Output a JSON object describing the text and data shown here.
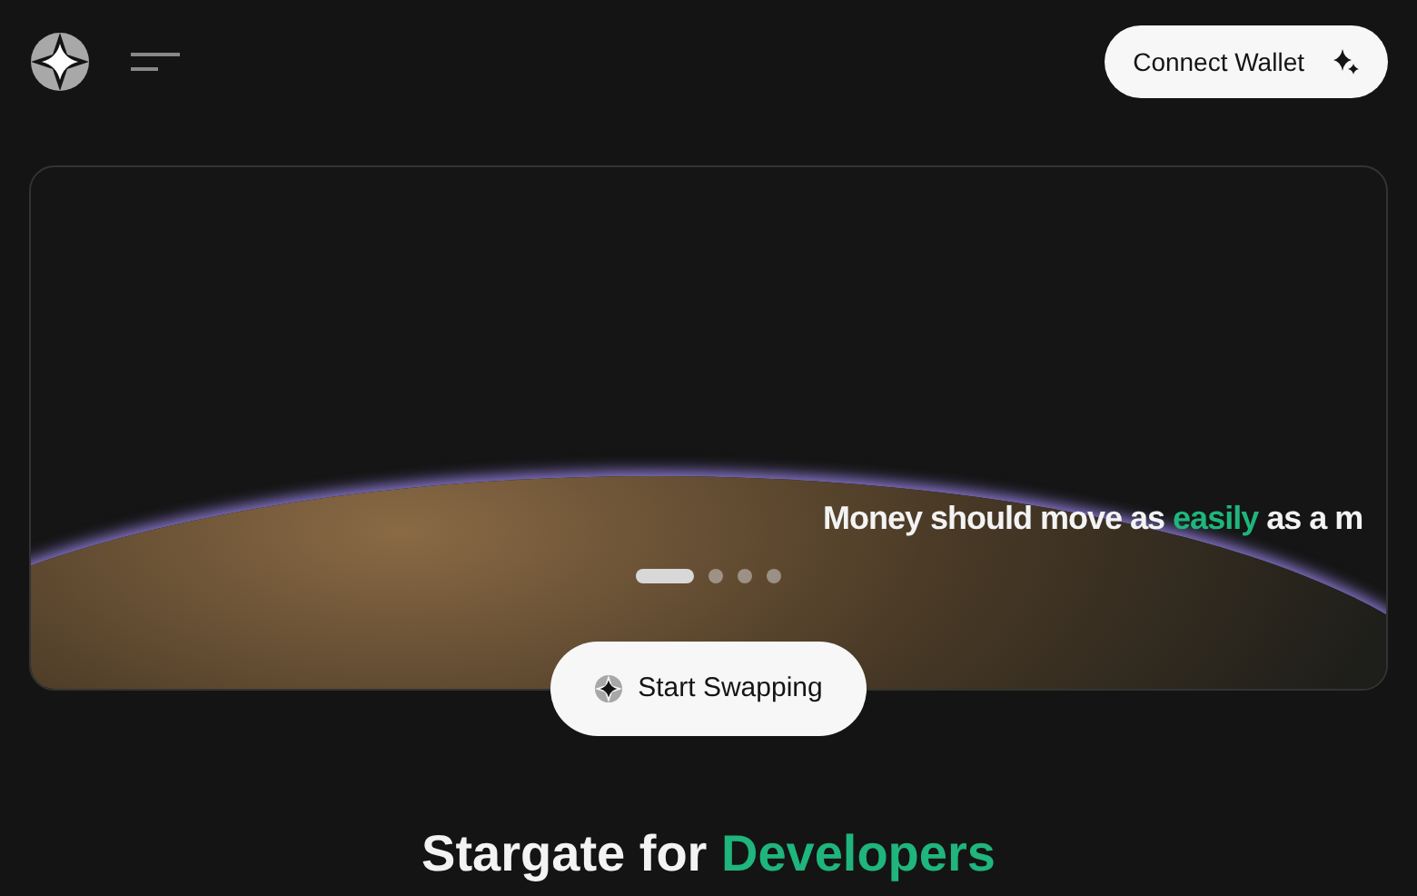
{
  "header": {
    "connect_button": "Connect Wallet"
  },
  "hero": {
    "tagline": [
      {
        "text": "Money should move as ",
        "highlight": false
      },
      {
        "text": "easily",
        "highlight": true
      },
      {
        "text": " as a m",
        "highlight": false
      }
    ],
    "slides": [
      {
        "selected": true
      },
      {
        "selected": false
      },
      {
        "selected": false
      },
      {
        "selected": false
      }
    ],
    "cta": "Start Swapping"
  },
  "section": {
    "heading": [
      {
        "text": "Stargate for ",
        "highlight": false
      },
      {
        "text": "Developers",
        "highlight": true
      }
    ]
  }
}
